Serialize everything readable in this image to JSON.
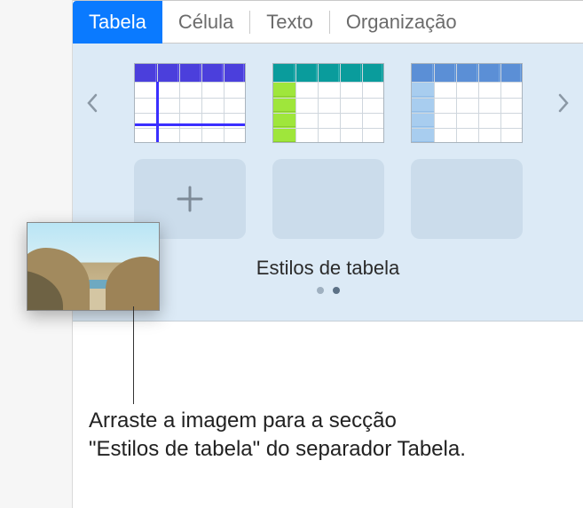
{
  "tabs": {
    "items": [
      {
        "label": "Tabela",
        "active": true
      },
      {
        "label": "Célula",
        "active": false
      },
      {
        "label": "Texto",
        "active": false
      },
      {
        "label": "Organização",
        "active": false
      }
    ]
  },
  "styles_section": {
    "title": "Estilos de tabela",
    "page_count": 2,
    "current_page": 1,
    "thumbs": [
      {
        "name": "table-style-purple"
      },
      {
        "name": "table-style-teal-lime"
      },
      {
        "name": "table-style-skyblue"
      }
    ],
    "add_label": "+"
  },
  "callout": {
    "text": "Arraste a imagem para a secção \"Estilos de tabela\" do separador Tabela."
  },
  "drag_item": {
    "kind": "image",
    "description": "beach-landscape"
  },
  "icons": {
    "chevron_left": "‹",
    "chevron_right": "›",
    "plus": "+"
  }
}
